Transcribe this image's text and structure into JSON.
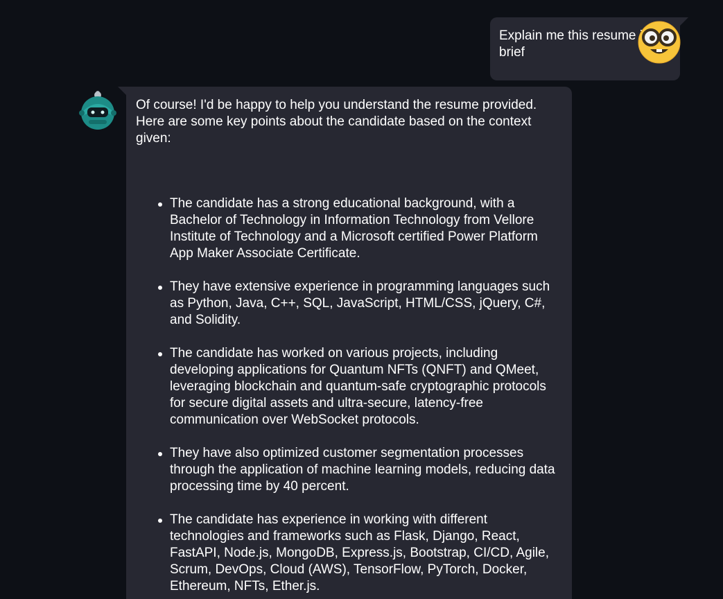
{
  "conversation": {
    "user_message": {
      "text": "Explain me this resume in brief",
      "avatar_icon": "nerd-face-emoji-icon"
    },
    "bot_message": {
      "avatar_icon": "robot-avatar-icon",
      "intro": "Of course! I'd be happy to help you understand the resume provided. Here are some key points about the candidate based on the context given:",
      "points": [
        "The candidate has a strong educational background, with a Bachelor of Technology in Information Technology from Vellore Institute of Technology and a Microsoft certified Power Platform App Maker Associate Certificate.",
        "They have extensive experience in programming languages such as Python, Java, C++, SQL, JavaScript, HTML/CSS, jQuery, C#, and Solidity.",
        "The candidate has worked on various projects, including developing applications for Quantum NFTs (QNFT) and QMeet, leveraging blockchain and quantum-safe cryptographic protocols for secure digital assets and ultra-secure, latency-free communication over WebSocket protocols.",
        "They have also optimized customer segmentation processes through the application of machine learning models, reducing data processing time by 40 percent.",
        "The candidate has experience in working with different technologies and frameworks such as Flask, Django, React, FastAPI, Node.js, MongoDB, Express.js, Bootstrap, CI/CD, Agile, Scrum, DevOps, Cloud (AWS), TensorFlow, PyTorch, Docker, Ethereum, NFTs, Ether.js."
      ]
    }
  },
  "colors": {
    "background": "#0d1016",
    "bubble": "#272832",
    "text": "#ffffff"
  }
}
